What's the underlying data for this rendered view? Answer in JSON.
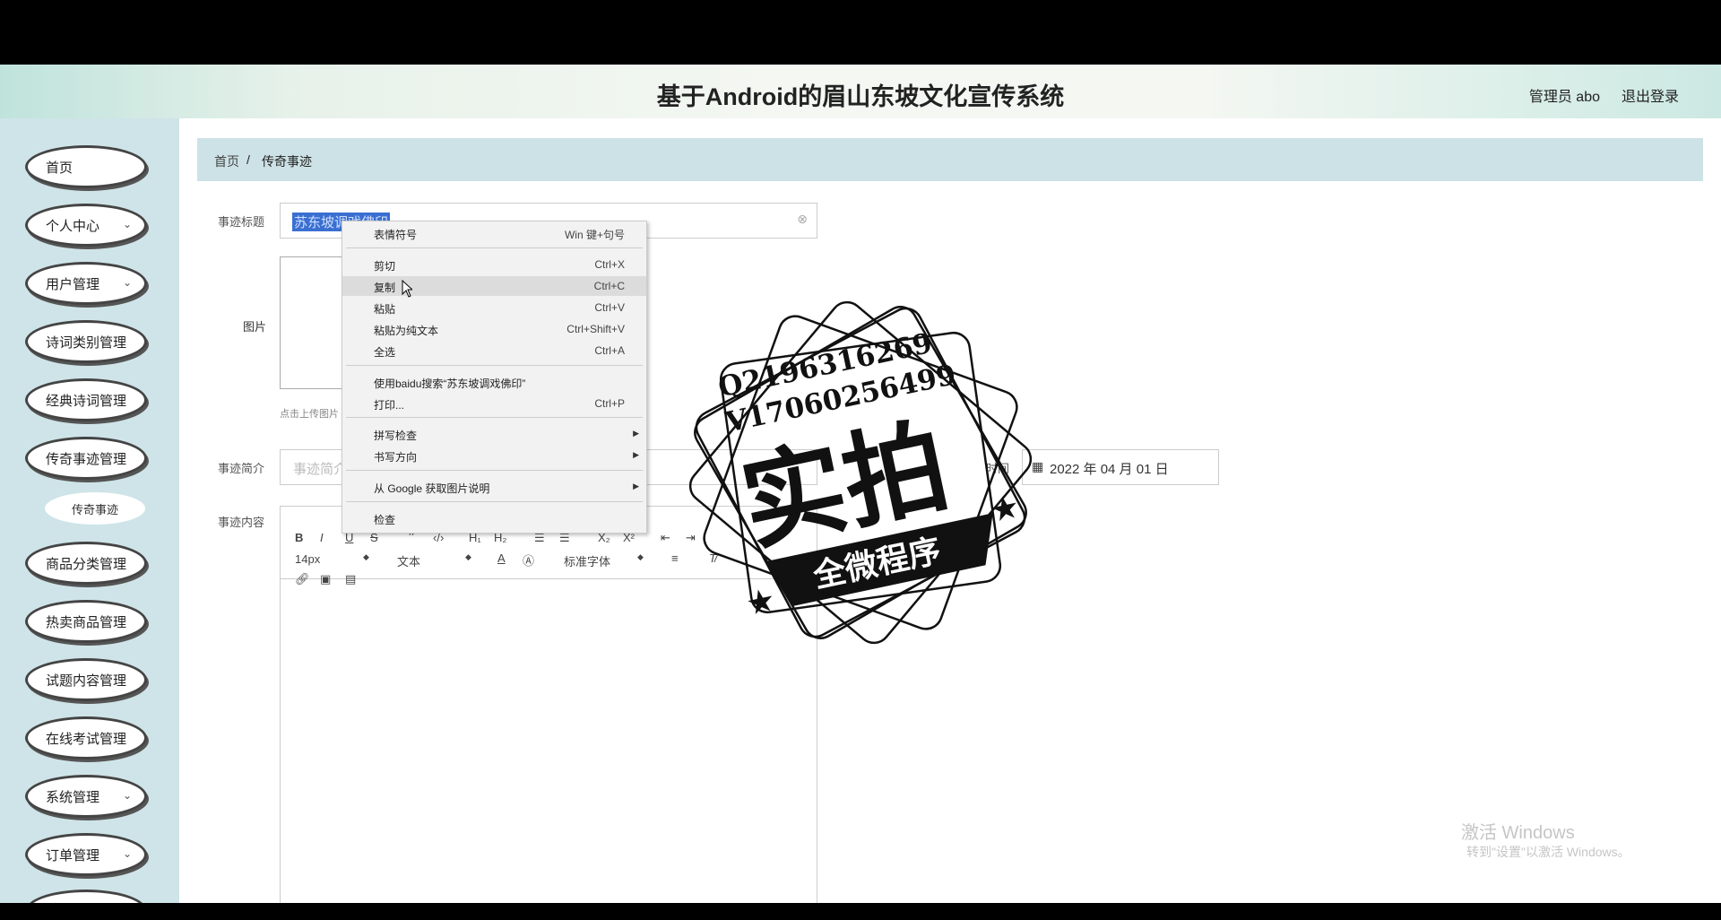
{
  "header": {
    "title": "基于Android的眉山东坡文化宣传系统",
    "user": "管理员 abo",
    "logout": "退出登录"
  },
  "sidebar": {
    "items": [
      {
        "label": "首页",
        "chev": ""
      },
      {
        "label": "个人中心",
        "chev": "⌄"
      },
      {
        "label": "用户管理",
        "chev": "⌄"
      },
      {
        "label": "诗词类别管理",
        "chev": ""
      },
      {
        "label": "经典诗词管理",
        "chev": ""
      },
      {
        "label": "传奇事迹管理",
        "chev": ""
      },
      {
        "label": "商品分类管理",
        "chev": ""
      },
      {
        "label": "热卖商品管理",
        "chev": ""
      },
      {
        "label": "试题内容管理",
        "chev": ""
      },
      {
        "label": "在线考试管理",
        "chev": ""
      },
      {
        "label": "系统管理",
        "chev": "⌄"
      },
      {
        "label": "订单管理",
        "chev": "⌄"
      }
    ],
    "sub": "传奇事迹"
  },
  "breadcrumb": {
    "home": "首页",
    "sep": "/",
    "current": "传奇事迹"
  },
  "form": {
    "title_label": "事迹标题",
    "title_value": "苏东坡调戏佛印",
    "image_label": "图片",
    "image_hint": "点击上传图片",
    "summary_label": "事迹简介",
    "summary_placeholder": "事迹简介",
    "time_label": "时间",
    "time_value": "2022 年 04 月 01 日",
    "content_label": "事迹内容"
  },
  "editor": {
    "font_size": "14px",
    "text_type": "文本",
    "font_family": "标准字体"
  },
  "context_menu": {
    "items": [
      {
        "label": "表情符号",
        "shortcut": "Win 键+句号"
      },
      {
        "label": "剪切",
        "shortcut": "Ctrl+X"
      },
      {
        "label": "复制",
        "shortcut": "Ctrl+C"
      },
      {
        "label": "粘贴",
        "shortcut": "Ctrl+V"
      },
      {
        "label": "粘贴为纯文本",
        "shortcut": "Ctrl+Shift+V"
      },
      {
        "label": "全选",
        "shortcut": "Ctrl+A"
      },
      {
        "label": "使用baidu搜索“苏东坡调戏佛印”",
        "shortcut": ""
      },
      {
        "label": "打印...",
        "shortcut": "Ctrl+P"
      },
      {
        "label": "拼写检查",
        "shortcut": ""
      },
      {
        "label": "书写方向",
        "shortcut": ""
      },
      {
        "label": "从 Google 获取图片说明",
        "shortcut": ""
      },
      {
        "label": "检查",
        "shortcut": ""
      }
    ]
  },
  "stamp": {
    "line1": "Q2196316269",
    "line2": "V17060256499",
    "big": "实拍",
    "banner": "全微程序"
  },
  "watermark": {
    "line1": "激活 Windows",
    "line2": "转到\"设置\"以激活 Windows。"
  }
}
